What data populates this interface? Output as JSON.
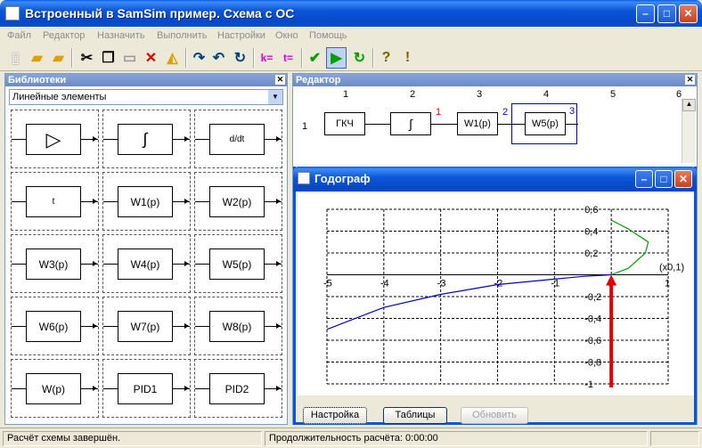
{
  "window": {
    "title": "Встроенный в SamSim пример. Схема с ОС"
  },
  "menu": [
    "Файл",
    "Редактор",
    "Назначить",
    "Выполнить",
    "Настройки",
    "Окно",
    "Помощь"
  ],
  "libraries": {
    "title": "Библиотеки",
    "category": "Линейные элементы",
    "blocks": [
      "▷",
      "∫",
      "d/dt",
      "t",
      "W1(p)",
      "W2(p)",
      "W3(p)",
      "W4(p)",
      "W5(p)",
      "W6(p)",
      "W7(p)",
      "W8(p)",
      "W(p)",
      "PID1",
      "PID2"
    ]
  },
  "editor": {
    "title": "Редактор",
    "columns": [
      "1",
      "2",
      "3",
      "4",
      "5",
      "6"
    ],
    "row": "1",
    "blocks": [
      "ГКЧ",
      "∫",
      "W1(p)",
      "W5(p)"
    ],
    "port_labels": [
      "1",
      "2",
      "3"
    ]
  },
  "hodograph": {
    "title": "Годограф",
    "buttons": {
      "settings": "Настройка",
      "tables": "Таблицы",
      "refresh": "Обновить"
    }
  },
  "chart_data": {
    "type": "line",
    "x_ticks": [
      "-5",
      "-4",
      "-3",
      "-2",
      "-1",
      "0",
      "1"
    ],
    "y_ticks": [
      "0,6",
      "0,4",
      "0,2",
      "-0,2",
      "-0,4",
      "-0,6",
      "-0,8",
      "-1"
    ],
    "x_unit_label": "(x0,1)",
    "xlim": [
      -5,
      1
    ],
    "ylim": [
      -1,
      0.6
    ],
    "series": [
      {
        "color": "#0000c0",
        "x": [
          -5.0,
          -4.0,
          -3.0,
          -2.0,
          -1.0,
          -0.5,
          0.0
        ],
        "y": [
          -0.5,
          -0.3,
          -0.18,
          -0.09,
          -0.04,
          -0.015,
          0.0
        ]
      },
      {
        "color": "#00a000",
        "x": [
          0.0,
          0.3,
          0.6,
          0.65,
          0.3,
          0.0
        ],
        "y": [
          0.0,
          0.06,
          0.2,
          0.3,
          0.42,
          0.5
        ]
      }
    ],
    "grid": true,
    "colors": {
      "arrow": "#e00000"
    }
  },
  "status": {
    "left": "Расчёт схемы завершён.",
    "right": "Продолжительность расчёта: 0:00:00"
  }
}
